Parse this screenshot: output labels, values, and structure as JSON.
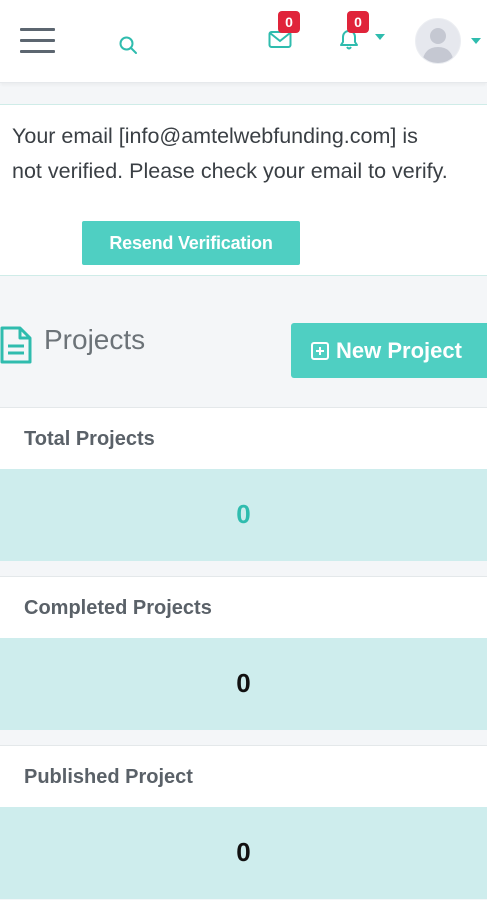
{
  "header": {
    "mail_badge": "0",
    "notifications_badge": "0"
  },
  "alert": {
    "message": "Your email [info@amtelwebfunding.com] is not verified. Please check your email to verify.",
    "resend_label": "Resend Verification"
  },
  "projects": {
    "title": "Projects",
    "new_project_label": "New Project"
  },
  "stats": [
    {
      "label": "Total Projects",
      "value": "0"
    },
    {
      "label": "Completed Projects",
      "value": "0"
    },
    {
      "label": "Published Project",
      "value": "0"
    }
  ],
  "colors": {
    "accent": "#4fcfc2",
    "badge": "#e0243a",
    "card_bg": "#ceeded"
  }
}
